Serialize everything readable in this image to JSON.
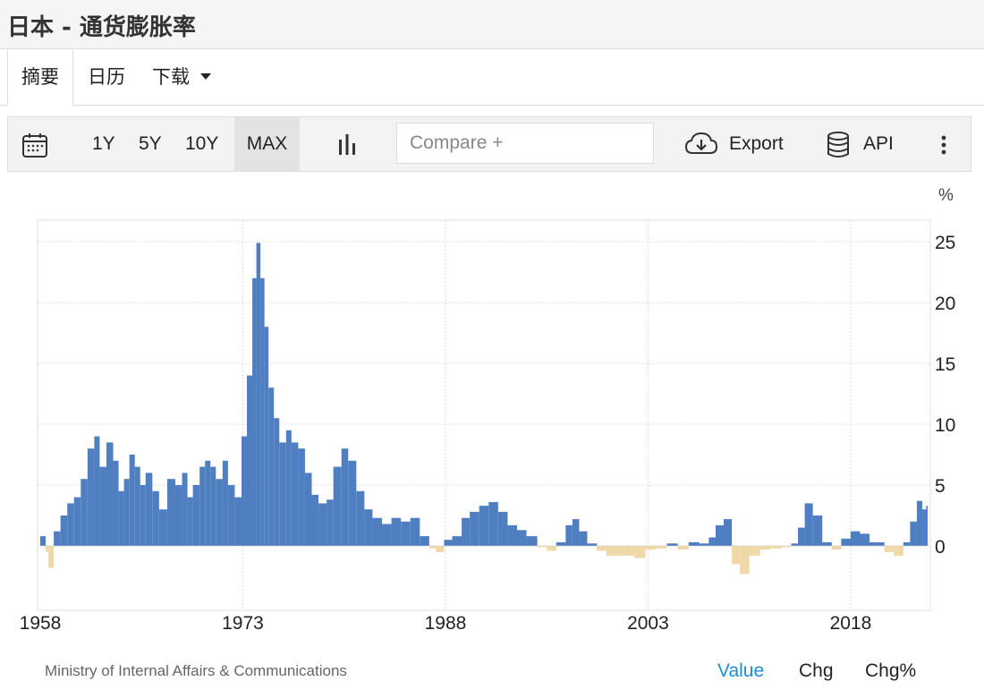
{
  "page": {
    "title": "日本 - 通货膨胀率"
  },
  "tabs": [
    {
      "label": "摘要",
      "active": true
    },
    {
      "label": "日历"
    },
    {
      "label": "下载"
    }
  ],
  "toolbar": {
    "periods": [
      "1Y",
      "5Y",
      "10Y",
      "MAX"
    ],
    "active_period": "MAX",
    "compare_placeholder": "Compare +",
    "export_label": "Export",
    "api_label": "API"
  },
  "footer": {
    "source": "Ministry of Internal Affairs & Communications",
    "modes": [
      "Value",
      "Chg",
      "Chg%"
    ],
    "active_mode": "Value"
  },
  "colors": {
    "positive": "#4f7fc1",
    "negative": "#f0d9a8",
    "accent": "#1a8fd6"
  },
  "chart_data": {
    "type": "bar",
    "title": "",
    "xlabel": "",
    "ylabel": "%",
    "ylim": [
      -5,
      27
    ],
    "xlim": [
      1958,
      2023.7
    ],
    "x_ticks": [
      "1958",
      "1973",
      "1988",
      "2003",
      "2018"
    ],
    "y_ticks": [
      "25",
      "20",
      "15",
      "10",
      "5",
      "0"
    ],
    "grid": true,
    "axis_position": "right",
    "series": [
      {
        "x": [
          1958,
          1958.4,
          1958.6,
          1959,
          1959.5,
          1960,
          1960.5,
          1961,
          1961.5,
          1962,
          1962.4,
          1962.9,
          1963.4,
          1963.8,
          1964.2,
          1964.6,
          1965,
          1965.4,
          1965.8,
          1966.3,
          1966.8,
          1967.4,
          1968,
          1968.5,
          1968.9,
          1969.3,
          1969.8,
          1970.2,
          1970.6,
          1971,
          1971.5,
          1971.9,
          1972.4,
          1972.9,
          1973.3,
          1973.7,
          1974,
          1974.3,
          1974.6,
          1974.9,
          1975.3,
          1975.7,
          1976.2,
          1976.6,
          1977.1,
          1977.6,
          1978.1,
          1978.6,
          1979.2,
          1979.7,
          1980.3,
          1980.8,
          1981.4,
          1982,
          1982.6,
          1983.3,
          1984,
          1984.7,
          1985.4,
          1986.1,
          1986.8,
          1987.3,
          1987.9,
          1988.5,
          1989.2,
          1989.8,
          1990.5,
          1991.2,
          1991.9,
          1992.6,
          1993.3,
          1994,
          1994.8,
          1995.5,
          1996.2,
          1996.9,
          1997.4,
          1997.9,
          1998.5,
          1999.2,
          1999.9,
          2000.6,
          2001.3,
          2002,
          2002.8,
          2003.6,
          2004.4,
          2005.2,
          2006,
          2006.8,
          2007.5,
          2008,
          2008.6,
          2009.2,
          2009.8,
          2010.5,
          2011.3,
          2012.1,
          2012.9,
          2013.6,
          2014.1,
          2014.6,
          2015.2,
          2015.9,
          2016.6,
          2017.3,
          2018,
          2018.7,
          2019.4,
          2019.9,
          2020.5,
          2021.2,
          2021.9,
          2022.4,
          2022.9,
          2023.3,
          2023.6
        ],
        "values": [
          0.8,
          -0.5,
          -1.8,
          1.2,
          2.5,
          3.5,
          4.0,
          5.5,
          8.0,
          9.0,
          6.5,
          8.5,
          7.0,
          4.5,
          5.5,
          7.5,
          6.5,
          5.0,
          6.0,
          4.5,
          3.0,
          5.5,
          5.0,
          6.0,
          4.0,
          5.0,
          6.5,
          7.0,
          6.5,
          5.5,
          7.0,
          5.0,
          4.0,
          9.0,
          14.0,
          22.0,
          24.9,
          22.0,
          18.0,
          13.0,
          10.5,
          8.5,
          9.5,
          8.5,
          8.0,
          6.0,
          4.2,
          3.5,
          3.8,
          6.5,
          8.0,
          7.0,
          4.5,
          3.0,
          2.3,
          1.8,
          2.3,
          2.0,
          2.3,
          0.8,
          -0.2,
          -0.5,
          0.5,
          0.8,
          2.3,
          2.8,
          3.3,
          3.6,
          2.8,
          1.7,
          1.3,
          0.8,
          -0.1,
          -0.4,
          0.3,
          1.7,
          2.2,
          1.2,
          0.2,
          -0.4,
          -0.8,
          -0.8,
          -0.8,
          -1.0,
          -0.3,
          -0.2,
          0.2,
          -0.3,
          0.3,
          0.2,
          0.7,
          1.7,
          2.2,
          -1.5,
          -2.3,
          -0.8,
          -0.3,
          -0.2,
          -0.1,
          0.2,
          1.5,
          3.5,
          2.5,
          0.3,
          -0.3,
          0.6,
          1.2,
          1.0,
          0.3,
          0.3,
          -0.5,
          -0.8,
          0.3,
          2.0,
          3.7,
          3.0,
          3.3
        ]
      }
    ]
  }
}
